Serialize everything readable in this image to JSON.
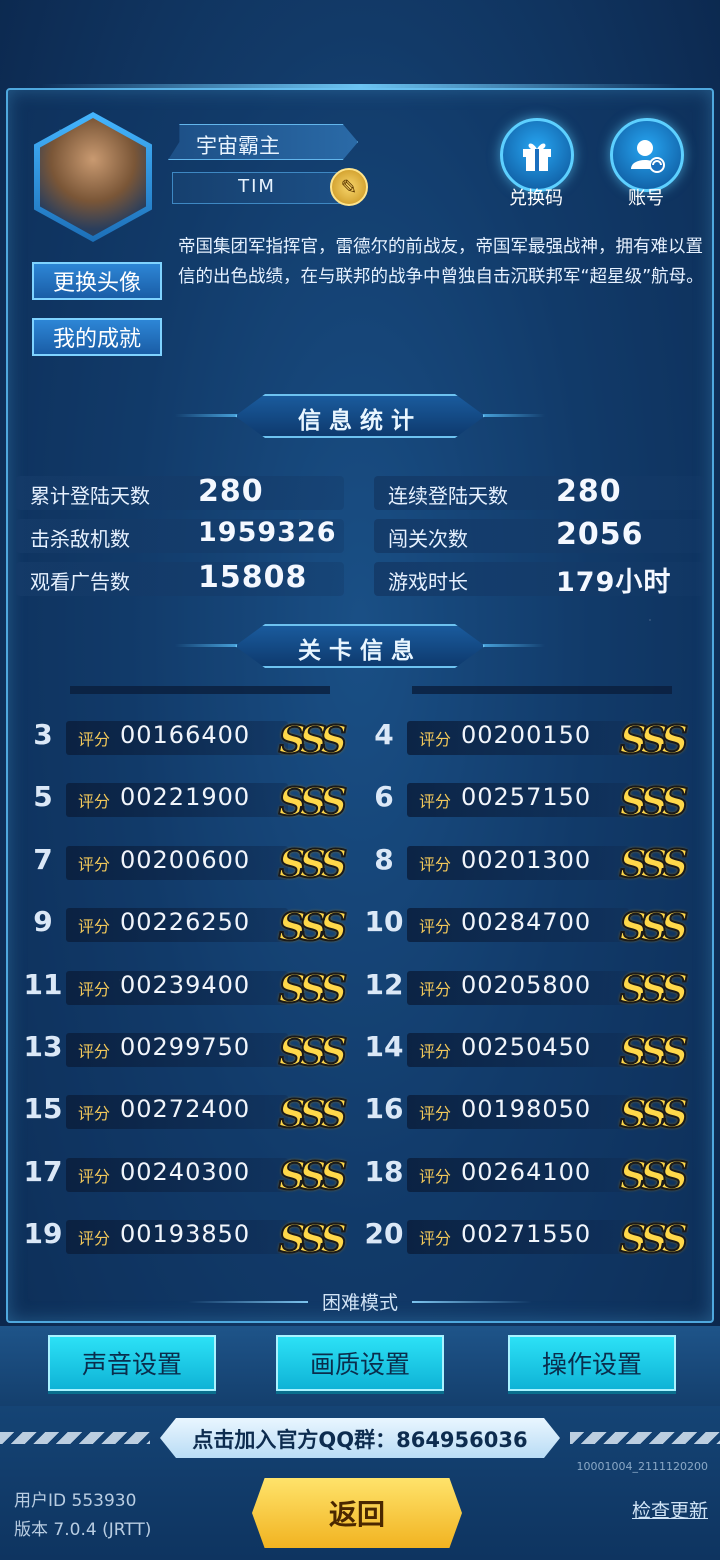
{
  "profile": {
    "name": "宇宙霸主",
    "tag": "TIM",
    "bio": "帝国集团军指挥官，雷德尔的前战友，帝国军最强战神，拥有难以置信的出色战绩，在与联邦的战争中曾独自击沉联邦军“超星级”航母。",
    "change_avatar": "更换头像",
    "achievements": "我的成就"
  },
  "top_buttons": {
    "redeem": "兑换码",
    "account": "账号"
  },
  "stats_title": "信息统计",
  "stats": [
    {
      "label": "累计登陆天数",
      "value": "280"
    },
    {
      "label": "连续登陆天数",
      "value": "280"
    },
    {
      "label": "击杀敌机数",
      "value": "1959326"
    },
    {
      "label": "闯关次数",
      "value": "2056"
    },
    {
      "label": "观看广告数",
      "value": "15808"
    },
    {
      "label": "游戏时长",
      "value": "179小时"
    }
  ],
  "levels_title": "关卡信息",
  "score_label": "评分",
  "levels": [
    {
      "num": "3",
      "score": "00166400",
      "grade": "SSS"
    },
    {
      "num": "4",
      "score": "00200150",
      "grade": "SSS"
    },
    {
      "num": "5",
      "score": "00221900",
      "grade": "SSS"
    },
    {
      "num": "6",
      "score": "00257150",
      "grade": "SSS"
    },
    {
      "num": "7",
      "score": "00200600",
      "grade": "SSS"
    },
    {
      "num": "8",
      "score": "00201300",
      "grade": "SSS"
    },
    {
      "num": "9",
      "score": "00226250",
      "grade": "SSS"
    },
    {
      "num": "10",
      "score": "00284700",
      "grade": "SSS"
    },
    {
      "num": "11",
      "score": "00239400",
      "grade": "SSS"
    },
    {
      "num": "12",
      "score": "00205800",
      "grade": "SSS"
    },
    {
      "num": "13",
      "score": "00299750",
      "grade": "SSS"
    },
    {
      "num": "14",
      "score": "00250450",
      "grade": "SSS"
    },
    {
      "num": "15",
      "score": "00272400",
      "grade": "SSS"
    },
    {
      "num": "16",
      "score": "00198050",
      "grade": "SSS"
    },
    {
      "num": "17",
      "score": "00240300",
      "grade": "SSS"
    },
    {
      "num": "18",
      "score": "00264100",
      "grade": "SSS"
    },
    {
      "num": "19",
      "score": "00193850",
      "grade": "SSS"
    },
    {
      "num": "20",
      "score": "00271550",
      "grade": "SSS"
    }
  ],
  "hard_mode": "困难模式",
  "settings": {
    "sound": "声音设置",
    "graphics": "画质设置",
    "controls": "操作设置"
  },
  "footer": {
    "qq_group": "点击加入官方QQ群：864956036",
    "build": "10001004_2111120200",
    "user_id": "用户ID 553930",
    "version": "版本 7.0.4 (JRTT)",
    "back": "返回",
    "check_update": "检查更新"
  },
  "colors": {
    "accent": "#5dd0ff",
    "grade_gold": "#ffd84a",
    "button_cyan": "#2ce1f6",
    "back_gold": "#f1b321"
  }
}
